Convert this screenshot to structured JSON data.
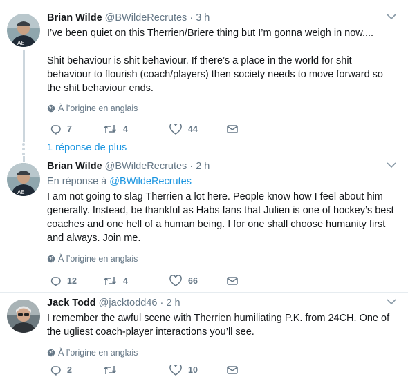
{
  "tweets": [
    {
      "name": "Brian Wilde",
      "handle": "@BWildeRecrutes",
      "time": "· 3 h",
      "text_lines": [
        "I’ve been quiet on this Therrien/Briere thing but I’m gonna weigh in now....",
        "Shit behaviour is shit behaviour. If there’s a place in the world for shit behaviour to flourish (coach/players) then society needs to move forward so the shit behaviour ends."
      ],
      "translate_label": "À l’origine en anglais",
      "replies": "7",
      "retweets": "4",
      "likes": "44"
    },
    {
      "name": "Brian Wilde",
      "handle": "@BWildeRecrutes",
      "time": "· 2 h",
      "reply_prefix": "En réponse à",
      "reply_mention": "@BWildeRecrutes",
      "text": "I am not going to slag Therrien a lot here. People know how I feel about him generally. Instead, be thankful as Habs fans that Julien is one of hockey’s best coaches and one hell of a human being. I for one shall choose humanity first and always. Join me.",
      "translate_label": "À l’origine en anglais",
      "replies": "12",
      "retweets": "4",
      "likes": "66"
    },
    {
      "name": "Jack Todd",
      "handle": "@jacktodd46",
      "time": "· 2 h",
      "text": "I remember the awful scene with Therrien humiliating P.K. from 24CH. One of the ugliest coach-player interactions you’ll see.",
      "translate_label": "À l’origine en anglais",
      "replies": "2",
      "retweets": "",
      "likes": "10"
    }
  ],
  "more_replies": "1 réponse de plus",
  "colors": {
    "text": "#14171a",
    "secondary": "#657786",
    "link": "#1b95e0",
    "thread_line": "#ccd6dd"
  },
  "icons": [
    "reply-icon",
    "retweet-icon",
    "like-icon",
    "direct-message-icon",
    "globe-icon",
    "caret-down-icon"
  ]
}
